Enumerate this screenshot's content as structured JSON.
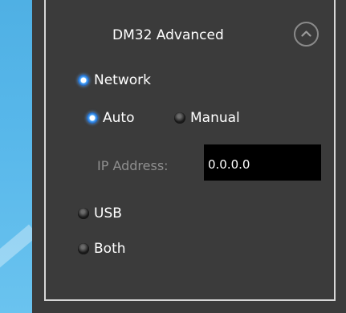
{
  "panel": {
    "title": "DM32 Advanced",
    "collapse_icon": "chevron-up-icon"
  },
  "connection": {
    "network_label": "Network",
    "usb_label": "USB",
    "both_label": "Both",
    "selected": "Network"
  },
  "addressing": {
    "auto_label": "Auto",
    "manual_label": "Manual",
    "selected": "Auto"
  },
  "ip": {
    "label": "IP Address:",
    "value": "0.0.0.0"
  },
  "colors": {
    "panel_bg": "#3b3b3b",
    "border": "#d7d7d7",
    "radio_selected": "#4aa8ff",
    "label_disabled": "#8f8f8f",
    "desktop_blue": "#57b7ea"
  }
}
